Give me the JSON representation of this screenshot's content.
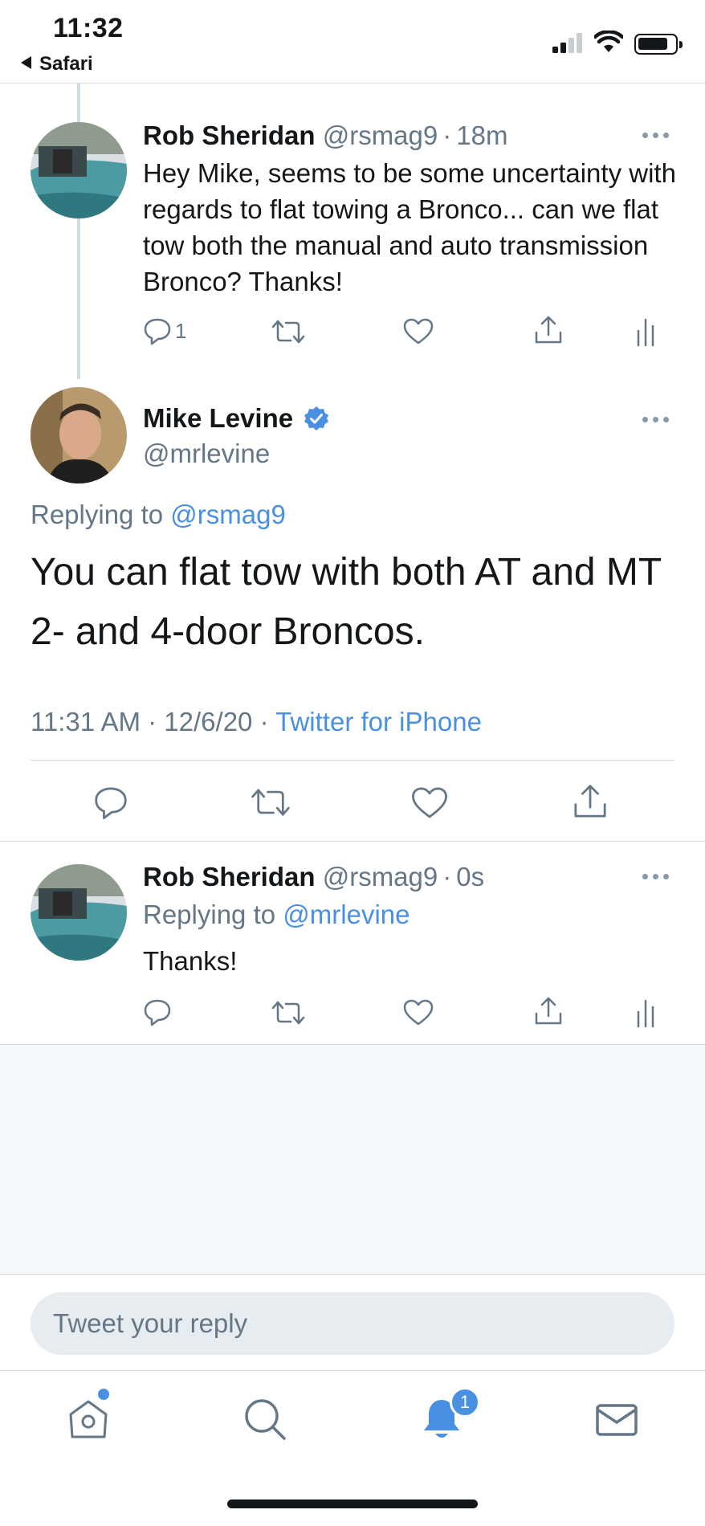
{
  "status_bar": {
    "time": "11:32",
    "back_app": "Safari"
  },
  "tweets": [
    {
      "name": "Rob Sheridan",
      "handle": "@rsmag9",
      "separator": "·",
      "time_ago": "18m",
      "text": "Hey Mike, seems to be some uncertainty with regards to flat towing a Bronco... can we flat tow both the manual and auto transmission Bronco?  Thanks!",
      "reply_count": "1"
    },
    {
      "name": "Mike Levine",
      "handle": "@mrlevine",
      "verified": true,
      "replying_to_label": "Replying to",
      "replying_to_handle": "@rsmag9",
      "text": "You can flat tow with both AT and MT 2- and 4-door Broncos.",
      "timestamp": "11:31 AM · 12/6/20 · ",
      "source": "Twitter for iPhone"
    },
    {
      "name": "Rob Sheridan",
      "handle": "@rsmag9",
      "separator": "·",
      "time_ago": "0s",
      "replying_to_label": "Replying to",
      "replying_to_handle": "@mrlevine",
      "text": "Thanks!"
    }
  ],
  "reply_box": {
    "placeholder": "Tweet your reply"
  },
  "tab_bar": {
    "notification_badge": "1",
    "items": [
      "home-icon",
      "search-icon",
      "notifications-icon",
      "messages-icon"
    ]
  },
  "colors": {
    "accent": "#4a90e2",
    "muted": "#657786",
    "text": "#14171a"
  }
}
